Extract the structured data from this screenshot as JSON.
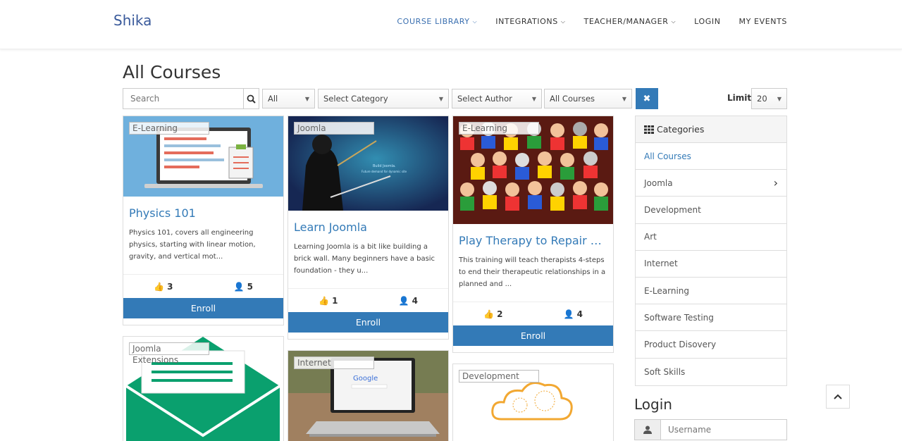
{
  "header": {
    "brand": "Shika",
    "nav": [
      {
        "label": "COURSE LIBRARY",
        "caret": "⌵"
      },
      {
        "label": "INTEGRATIONS",
        "caret": "⌵"
      },
      {
        "label": "TEACHER/MANAGER",
        "caret": "⌵"
      },
      {
        "label": "LOGIN"
      },
      {
        "label": "MY EVENTS"
      }
    ]
  },
  "page_title": "All Courses",
  "filters": {
    "search_placeholder": "Search",
    "status": "All",
    "category": "Select Category",
    "author": "Select Author",
    "course_type": "All Courses",
    "limit_label": "Limit",
    "limit_value": "20"
  },
  "courses": [
    {
      "category": "E-Learning",
      "title": "Physics 101",
      "description": "Physics 101, covers all engineering physics, starting with linear motion, gravity, and vertical mot...",
      "likes": "3",
      "enrolled": "5",
      "enroll_label": "Enroll"
    },
    {
      "category": "Joomla",
      "title": "Learn Joomla",
      "description": "Learning Joomla is a bit like building a brick wall. Many beginners have a basic foundation - they u...",
      "likes": "1",
      "enrolled": "4",
      "enroll_label": "Enroll"
    },
    {
      "category": "E-Learning",
      "title": "Play Therapy to Repair Atta...",
      "description": "This training will teach therapists 4-steps to end their therapeutic relationships in a planned and ...",
      "likes": "2",
      "enrolled": "4",
      "enroll_label": "Enroll"
    },
    {
      "category": "Joomla Extensions"
    },
    {
      "category": "Internet"
    },
    {
      "category": "Development"
    }
  ],
  "sidebar": {
    "categories_title": "Categories",
    "items": [
      "All Courses",
      "Joomla",
      "Development",
      "Art",
      "Internet",
      "E-Learning",
      "Software Testing",
      "Product Disovery",
      "Soft Skills"
    ],
    "login_title": "Login",
    "username_placeholder": "Username"
  },
  "colors": {
    "primary": "#337ab7",
    "brand": "#3a5a9b"
  }
}
